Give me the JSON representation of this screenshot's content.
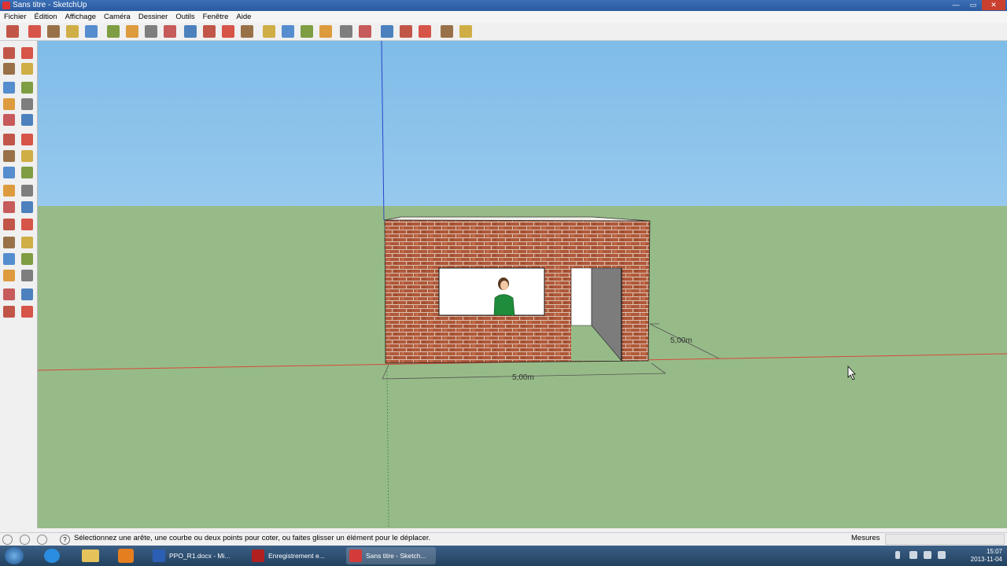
{
  "window": {
    "title": "Sans titre - SketchUp",
    "btn_minimize": "—",
    "btn_maximize": "▭",
    "btn_close": "✕"
  },
  "menu": [
    "Fichier",
    "Édition",
    "Affichage",
    "Caméra",
    "Dessiner",
    "Outils",
    "Fenêtre",
    "Aide"
  ],
  "toolbar_icons": [
    "select-icon",
    "pencil-icon",
    "rectangle-icon",
    "circle-icon",
    "arc-icon",
    "eraser-icon",
    "paint-bucket-icon",
    "offset-icon",
    "move-icon",
    "push-pull-icon",
    "rotate-icon",
    "follow-me-icon",
    "orbit-icon",
    "pan-icon",
    "zoom-icon",
    "zoom-extents-icon",
    "tape-measure-icon",
    "protractor-icon",
    "walk-icon",
    "position-camera-icon",
    "look-around-icon",
    "section-icon",
    "layers-icon",
    "components-icon"
  ],
  "left_tools": [
    [
      "select-icon",
      "eraser-icon"
    ],
    [
      "paint-bucket-icon",
      "pencil-icon"
    ],
    [
      "rectangle-icon",
      "line-icon"
    ],
    [
      "circle-icon",
      "arc-icon"
    ],
    [
      "polygon-icon",
      "freehand-icon"
    ],
    [
      "move-icon",
      "push-pull-icon"
    ],
    [
      "rotate-icon",
      "follow-me-icon"
    ],
    [
      "scale-icon",
      "offset-icon"
    ],
    [
      "tape-measure-icon",
      "dimension-icon"
    ],
    [
      "protractor-icon",
      "text-icon"
    ],
    [
      "axes-icon",
      "3d-text-icon"
    ],
    [
      "orbit-icon",
      "pan-icon"
    ],
    [
      "zoom-icon",
      "zoom-window-icon"
    ],
    [
      "previous-view-icon",
      "next-view-icon"
    ],
    [
      "position-camera-icon",
      "look-around-icon"
    ],
    [
      "walk-icon",
      "section-plane-icon"
    ]
  ],
  "dimensions": {
    "width_label": "5,00m",
    "depth_label": "5,00m"
  },
  "status": {
    "message": "Sélectionnez une arête, une courbe ou deux points pour coter, ou faites glisser un élément pour le déplacer.",
    "measure_label": "Mesures",
    "measure_value": ""
  },
  "taskbar": {
    "items": [
      {
        "label": "PPO_R1.docx - Mi...",
        "color": "#2b5fb4"
      },
      {
        "label": "Enregistrement e...",
        "color": "#b02020"
      },
      {
        "label": "Sans titre - Sketch...",
        "color": "#d33b3b"
      }
    ],
    "time": "15:07",
    "date": "2013-11-04"
  }
}
